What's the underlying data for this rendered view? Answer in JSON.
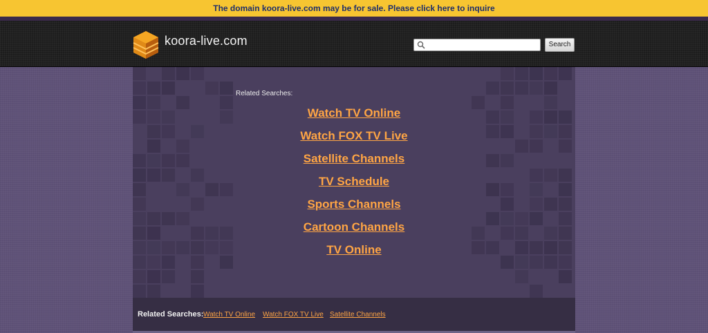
{
  "banner": {
    "text": "The domain koora-live.com may be for sale. Please click here to inquire",
    "background": "#f7c531",
    "text_color": "#1f2f6b"
  },
  "header": {
    "site_name": "koora-live.com",
    "logo_icon": "orange-stacked-cube-icon",
    "search": {
      "value": "",
      "placeholder": "",
      "icon": "search-icon",
      "button_label": "Search"
    }
  },
  "main": {
    "related_title": "Related Searches:",
    "links": [
      {
        "label": "Watch TV Online"
      },
      {
        "label": "Watch FOX TV Live"
      },
      {
        "label": "Satellite Channels"
      },
      {
        "label": "TV Schedule"
      },
      {
        "label": "Sports Channels"
      },
      {
        "label": "Cartoon Channels"
      },
      {
        "label": "TV Online"
      }
    ],
    "link_color": "#ffa544",
    "panel_color": "#4a3f5e"
  },
  "footer": {
    "label": "Related Searches:",
    "links": [
      {
        "label": "Watch TV Online"
      },
      {
        "label": "Watch FOX TV Live"
      },
      {
        "label": "Satellite Channels"
      }
    ]
  },
  "colors": {
    "page_background": "#5f5278",
    "header_background": "#1d1d1d",
    "footer_background": "#362e44"
  }
}
